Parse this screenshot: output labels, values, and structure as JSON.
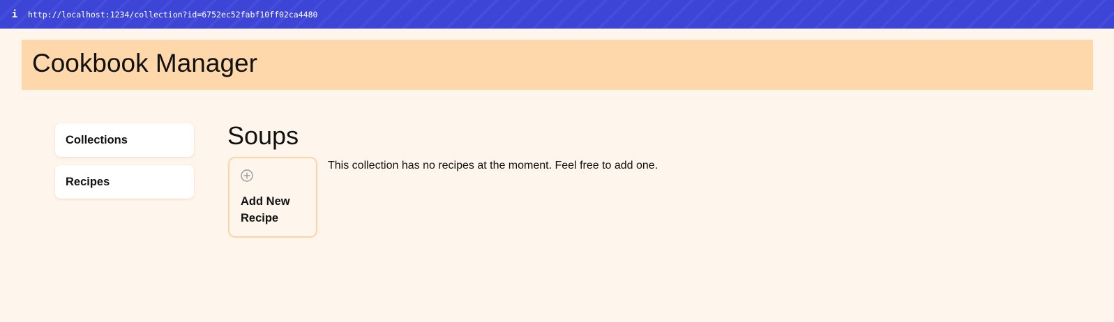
{
  "browser": {
    "info_icon": "i",
    "url": "http://localhost:1234/collection?id=6752ec52fabf10ff02ca4480"
  },
  "header": {
    "title": "Cookbook Manager"
  },
  "sidebar": {
    "items": [
      {
        "label": "Collections"
      },
      {
        "label": "Recipes"
      }
    ]
  },
  "main": {
    "collection_title": "Soups",
    "add_card": {
      "icon": "plus-circle-icon",
      "label": "Add New Recipe"
    },
    "empty_message": "This collection has no recipes at the moment. Feel free to add one."
  }
}
